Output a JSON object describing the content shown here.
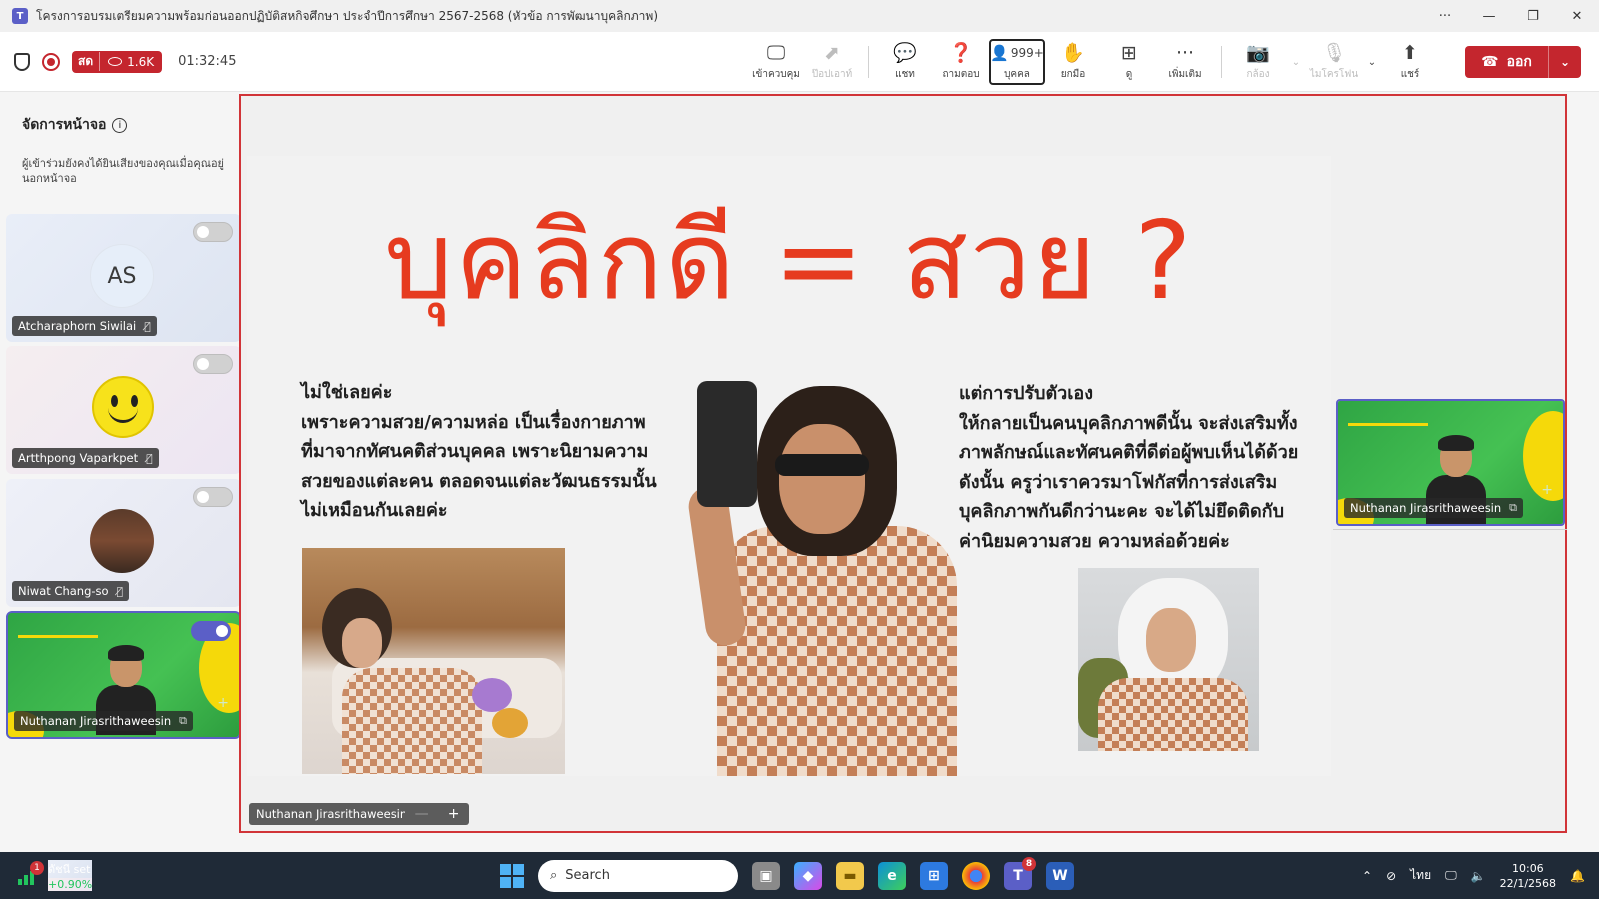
{
  "window": {
    "title": "โครงการอบรมเตรียมความพร้อมก่อนออกปฏิบัติสหกิจศึกษา ประจำปีการศึกษา 2567-2568 (หัวข้อ การพัฒนาบุคลิกภาพ)",
    "more": "···",
    "minimize": "—",
    "restore": "❐",
    "close": "✕"
  },
  "meeting": {
    "live_label": "สด",
    "viewers": "1.6K",
    "elapsed": "01:32:45"
  },
  "toolbar": {
    "buttons": [
      {
        "icon": "🖵",
        "label": "เข้าควบคุม"
      },
      {
        "icon": "⬈",
        "label": "ป๊อปเอาท์"
      },
      {
        "icon": "💬",
        "label": "แชท"
      },
      {
        "icon": "❓",
        "label": "ถามตอบ"
      },
      {
        "icon": "👤",
        "label": "บุคคล",
        "count": "999+"
      },
      {
        "icon": "✋",
        "label": "ยกมือ"
      },
      {
        "icon": "⊞",
        "label": "ดู"
      },
      {
        "icon": "···",
        "label": "เพิ่มเติม"
      },
      {
        "icon": "📷",
        "label": "กล้อง"
      },
      {
        "icon": "🎙",
        "label": "ไมโครโฟน"
      },
      {
        "icon": "⬆",
        "label": "แชร์"
      }
    ],
    "leave_label": "ออก"
  },
  "sidebar": {
    "title": "จัดการหน้าจอ",
    "description": "ผู้เข้าร่วมยังคงได้ยินเสียงของคุณเมื่อคุณอยู่นอกหน้าจอ",
    "participants": [
      {
        "name": "Atcharaphorn Siwilai",
        "initials": "AS",
        "on_screen": false
      },
      {
        "name": "Artthpong Vaparkpet",
        "on_screen": false
      },
      {
        "name": "Niwat Chang-so",
        "on_screen": false
      },
      {
        "name": "Nuthanan Jirasrithaweesin",
        "on_screen": true
      }
    ]
  },
  "slide": {
    "title": "บุคลิกดี = สวย ?",
    "left_text": "ไม่ใช่เลยค่ะ\nเพราะความสวย/ความหล่อ เป็นเรื่องกายภาพ\nที่มาจากทัศนคติส่วนบุคคล เพราะนิยามความ\nสวยของแต่ละคน ตลอดจนแต่ละวัฒนธรรมนั้น\nไม่เหมือนกันเลยค่ะ",
    "right_text": "แต่การปรับตัวเอง\nให้กลายเป็นคนบุคลิกภาพดีนั้น จะส่งเสริมทั้ง\nภาพลักษณ์และทัศนคติที่ดีต่อผู้พบเห็นได้ด้วย\nดังนั้น ครูว่าเราควรมาโฟกัสที่การส่งเสริม\nบุคลิกภาพกันดีกว่านะคะ จะได้ไม่ยึดติดกับ\nค่านิยมความสวย ความหล่อด้วยค่ะ"
  },
  "stage": {
    "presenter_tag": "Nuthanan Jirasrithaweesin",
    "pip_name": "Nuthanan Jirasrithaweesin",
    "zoom_out": "—",
    "zoom_in": "+"
  },
  "taskbar": {
    "stock_name": "ดัชนี set",
    "stock_change": "+0.90%",
    "stock_badge": "1",
    "search_placeholder": "Search",
    "teams_badge": "8",
    "language": "ไทย",
    "time": "10:06",
    "date": "22/1/2568"
  },
  "colors": {
    "accent": "#5b5fc7",
    "leave": "#c4262e",
    "slide_title": "#e63b1f",
    "stage_border": "#d13438"
  }
}
